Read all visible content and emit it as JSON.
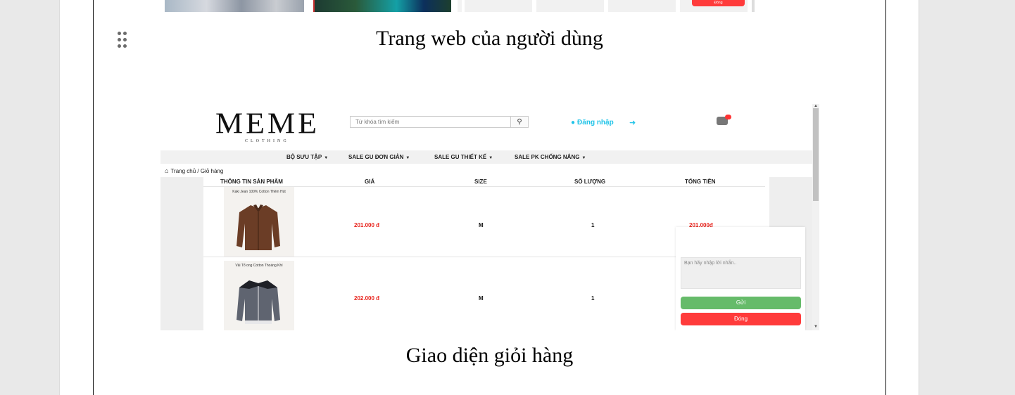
{
  "captions": {
    "user_site": "Trang web của người dùng",
    "cart_ui": "Giao diện giỏi hàng"
  },
  "top_strip": {
    "close_label": "Đóng"
  },
  "shot": {
    "logo": "MEME",
    "logo_sub": "CLOTHING",
    "search_placeholder": "Từ khóa tìm kiếm",
    "login_label": "Đăng nhập",
    "nav": [
      "BỘ SƯU TẬP",
      "SALE GU ĐƠN GIẢN",
      "SALE GU THIẾT KẾ",
      "SALE PK CHỐNG NẮNG"
    ],
    "breadcrumb": "Trang chủ / Giỏ hàng",
    "table_headers": [
      "THÔNG TIN SẢN PHẨM",
      "GIÁ",
      "SIZE",
      "SỐ LƯỢNG",
      "TỔNG TIỀN"
    ],
    "rows": [
      {
        "name": "Kaki Jean 100% Cotton Thêm Hút",
        "price": "201.000 đ",
        "size": "M",
        "qty": "1",
        "total": "201.000đ"
      },
      {
        "name": "Vải Tổ ong Cotton Thoáng Khí",
        "price": "202.000 đ",
        "size": "M",
        "qty": "1",
        "total": ""
      }
    ],
    "chat": {
      "placeholder": "Bạn hãy nhập lời nhắn..",
      "send_label": "Gửi",
      "close_label": "Đóng"
    }
  },
  "colors": {
    "login": "#22c4e8",
    "price": "#e8221b",
    "send": "#66bb6a",
    "close": "#ff3b3b"
  }
}
